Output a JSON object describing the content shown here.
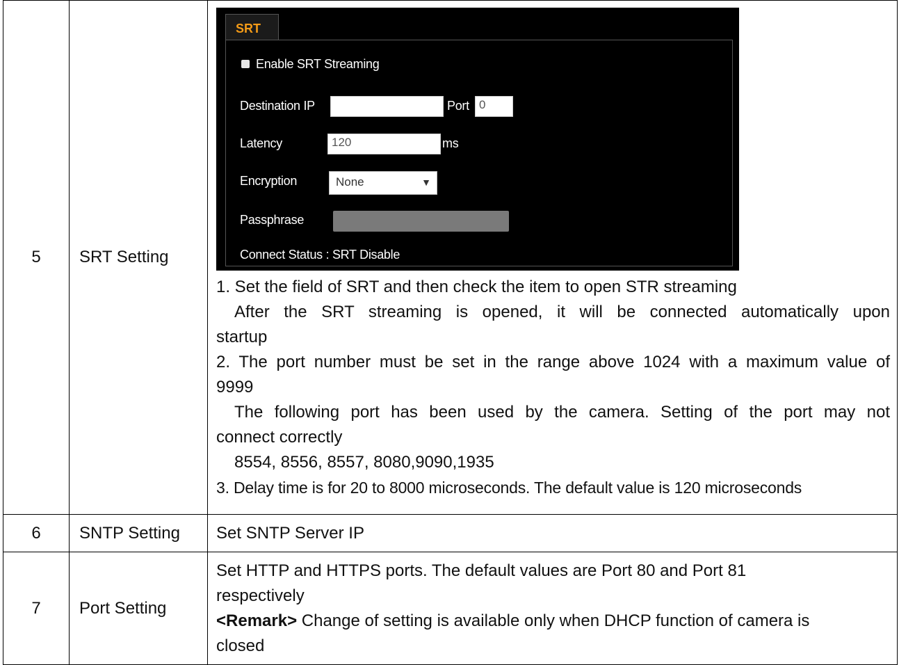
{
  "rows": [
    {
      "number": "5",
      "name": "SRT Setting",
      "srt_panel": {
        "tab_label": "SRT",
        "enable_label": "Enable SRT Streaming",
        "destination_ip_label": "Destination IP",
        "destination_ip_value": "",
        "port_label": "Port",
        "port_value": "0",
        "latency_label": "Latency",
        "latency_value": "120",
        "latency_unit": "ms",
        "encryption_label": "Encryption",
        "encryption_value": "None",
        "passphrase_label": "Passphrase",
        "connect_status": "Connect Status : SRT Disable"
      },
      "lines": [
        "1. Set the field of SRT and then check the item to open STR streaming",
        "After the SRT streaming is opened, it will be connected automatically upon",
        "startup",
        "2. The port number must be set in the range above 1024 with a maximum value of",
        "9999",
        "The following port has been used by the camera. Setting of the port may not",
        "connect correctly",
        "8554, 8556, 8557, 8080,9090,1935",
        "3. Delay time is for 20 to 8000 microseconds. The default value is 120 microseconds"
      ]
    },
    {
      "number": "6",
      "name": "SNTP Setting",
      "description": "Set SNTP Server IP"
    },
    {
      "number": "7",
      "name": "Port Setting",
      "lines": [
        "Set HTTP and HTTPS ports. The default values are Port 80 and Port 81",
        "respectively"
      ],
      "remark_label": "<Remark>",
      "remark_text": " Change of setting is available only when DHCP function of camera is",
      "remark_text_2": "closed"
    }
  ]
}
